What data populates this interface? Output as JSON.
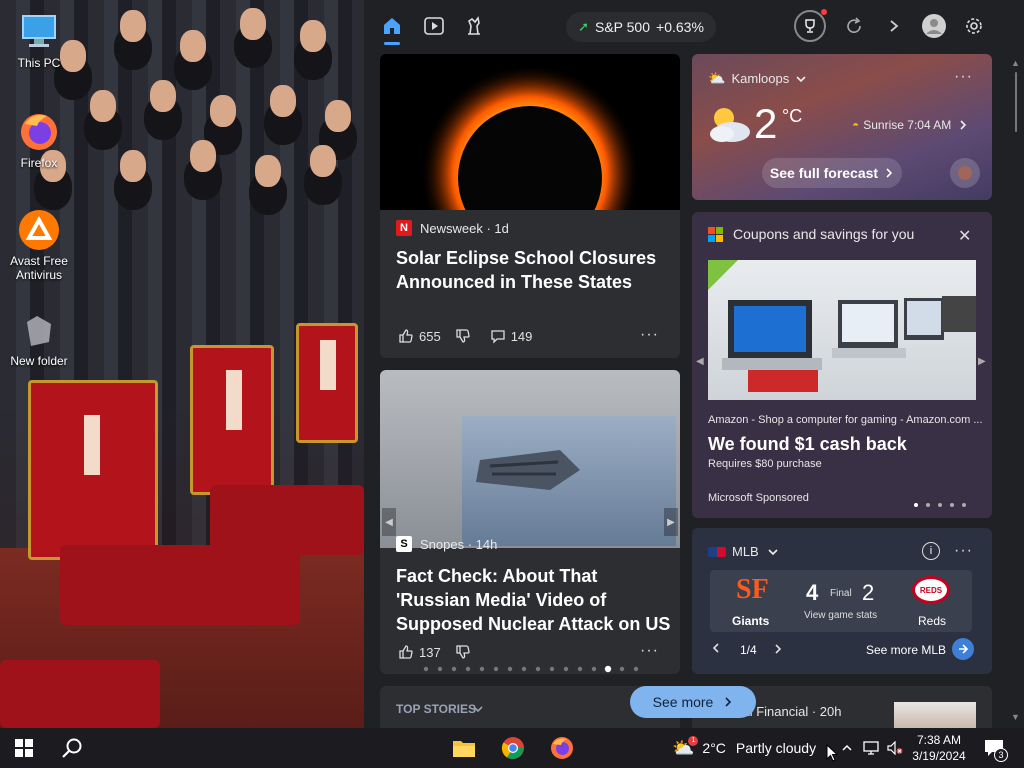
{
  "desktop": {
    "icons": [
      {
        "label": "This PC"
      },
      {
        "label": "Firefox"
      },
      {
        "label": "Avast Free Antivirus"
      },
      {
        "label": "New folder"
      }
    ]
  },
  "panel": {
    "market": {
      "name": "S&P 500",
      "change": "+0.63%"
    },
    "articles": [
      {
        "source": "Newsweek · 1d",
        "headline": "Solar Eclipse School Closures Announced in These States",
        "likes": "655",
        "comments": "149"
      },
      {
        "source": "Snopes · 14h",
        "headline": "Fact Check: About That 'Russian Media' Video of Supposed Nuclear Attack on US",
        "likes": "137"
      }
    ],
    "weather": {
      "location": "Kamloops",
      "temp": "2",
      "unit": "°C",
      "sunrise": "Sunrise 7:04 AM",
      "forecast_label": "See full forecast"
    },
    "coupons": {
      "title": "Coupons and savings for you",
      "merchant": "Amazon - Shop a computer for gaming - Amazon.com ...",
      "headline": "We found $1 cash back",
      "requirement": "Requires $80 purchase",
      "sponsor": "Microsoft Sponsored"
    },
    "mlb": {
      "league": "MLB",
      "home_team": "Giants",
      "home_score": "4",
      "status": "Final",
      "stats_label": "View game stats",
      "away_score": "2",
      "away_team": "Reds",
      "page": "1/4",
      "more_label": "See more MLB"
    },
    "bottom": {
      "top_stories": "TOP STORIES",
      "see_more": "See more",
      "partial_source": "cal Financial · 20h"
    }
  },
  "taskbar": {
    "weather_temp": "2°C",
    "weather_desc": "Partly cloudy",
    "time": "7:38 AM",
    "date": "3/19/2024",
    "notification_count": "3"
  },
  "colors": {
    "accent": "#4aa3ff",
    "panel_bg": "#202124",
    "card_bg": "#2d2e31",
    "market_up": "#40d46a"
  }
}
